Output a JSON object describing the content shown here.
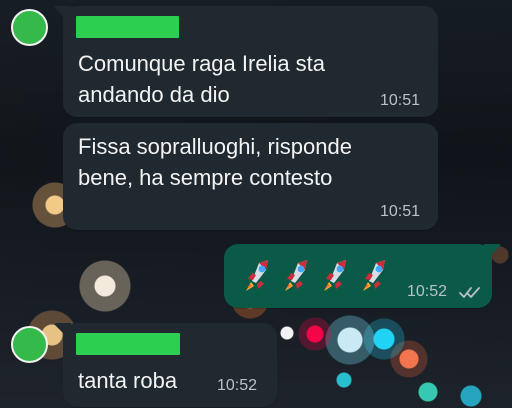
{
  "messages": [
    {
      "text": "Comunque raga Irelia sta\nandando da dio",
      "time": "10:51"
    },
    {
      "text": "Fissa sopralluoghi, risponde\nbene, ha sempre contesto",
      "time": "10:51"
    },
    {
      "time": "10:52",
      "emoji": [
        "rocket",
        "rocket",
        "rocket",
        "rocket"
      ],
      "status_icon": "double-check-icon"
    },
    {
      "text": "tanta roba",
      "time": "10:52"
    }
  ],
  "colors": {
    "incoming_bubble": "#20292f",
    "outgoing_bubble": "#0b5a47",
    "sender_name_highlight": "#2dcf51",
    "avatar": "#35b94a",
    "message_text": "#f3f3f3",
    "timestamp": "#b8c2c7"
  }
}
